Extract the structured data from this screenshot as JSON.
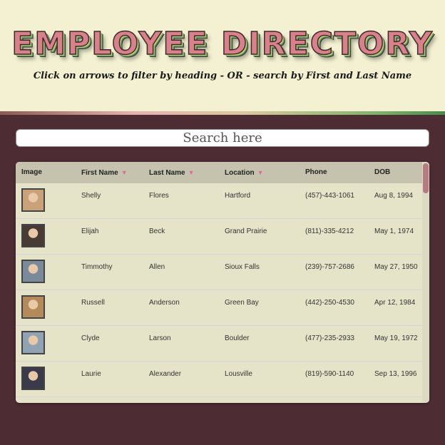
{
  "header": {
    "title": "EMPLOYEE DIRECTORY",
    "subtitle": "Click on arrows to filter by heading - OR - search by First and Last Name"
  },
  "search": {
    "placeholder": "Search here",
    "value": ""
  },
  "table": {
    "columns": {
      "image": "Image",
      "first": "First Name",
      "last": "Last Name",
      "location": "Location",
      "phone": "Phone",
      "dob": "DOB"
    },
    "sort_arrow": "▼",
    "rows": [
      {
        "first": "Shelly",
        "last": "Flores",
        "location": "Hartford",
        "phone": "(457)-443-1061",
        "dob": "Aug 8, 1994",
        "avatar_color": "#c9a27a"
      },
      {
        "first": "Elijah",
        "last": "Beck",
        "location": "Grand Prairie",
        "phone": "(811)-335-4212",
        "dob": "May 1, 1974",
        "avatar_color": "#4a3a34"
      },
      {
        "first": "Timmothy",
        "last": "Allen",
        "location": "Sioux Falls",
        "phone": "(239)-757-2686",
        "dob": "May 27, 1950",
        "avatar_color": "#7a8a9a"
      },
      {
        "first": "Russell",
        "last": "Anderson",
        "location": "Green Bay",
        "phone": "(442)-250-4530",
        "dob": "Apr 12, 1984",
        "avatar_color": "#b58a5a"
      },
      {
        "first": "Clyde",
        "last": "Larson",
        "location": "Boulder",
        "phone": "(477)-235-2933",
        "dob": "May 19, 1972",
        "avatar_color": "#8fa3b5"
      },
      {
        "first": "Laurie",
        "last": "Alexander",
        "location": "Lousville",
        "phone": "(819)-590-1140",
        "dob": "Sep 13, 1996",
        "avatar_color": "#3a3a4a"
      }
    ]
  }
}
